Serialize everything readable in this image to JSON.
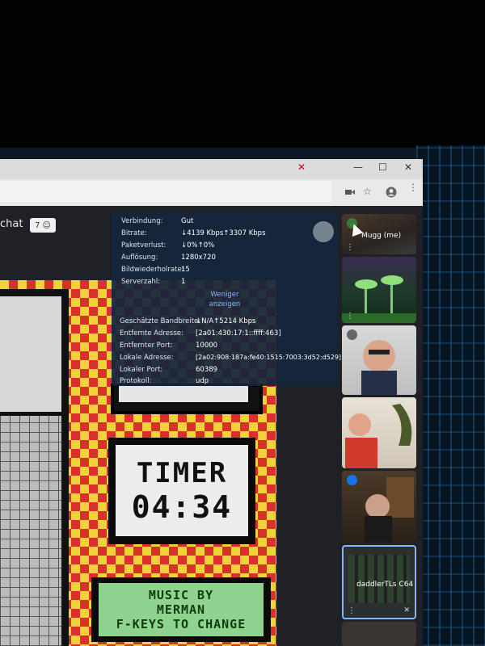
{
  "stats": {
    "rows_top": [
      {
        "label": "Verbindung:",
        "value": "Gut"
      },
      {
        "label": "Bitrate:",
        "value": "↓4139 Kbps↑3307 Kbps"
      },
      {
        "label": "Paketverlust:",
        "value": "↓0%↑0%"
      },
      {
        "label": "Auflösung:",
        "value": "1280x720"
      },
      {
        "label": "Bildwiederholrate:",
        "value": "15"
      },
      {
        "label": "Serverzahl:",
        "value": "1"
      }
    ],
    "toggle_line1": "Weniger",
    "toggle_line2": "anzeigen",
    "rows_bottom": [
      {
        "label": "Geschätzte Bandbreite:",
        "value": "↓N/A↑5214 Kbps"
      },
      {
        "label": "Entfernte Adresse:",
        "value": "[2a01:430:17:1::ffff:463]"
      },
      {
        "label": "Entfernter Port:",
        "value": "10000"
      },
      {
        "label": "Lokale Adresse:",
        "value": "[2a02:908:187a:fe40:1515:7003:3d52:d529]"
      },
      {
        "label": "Lokaler Port:",
        "value": "60389"
      },
      {
        "label": "Protokoll:",
        "value": "udp"
      }
    ]
  },
  "chat": {
    "label": "chat",
    "badge_count": "7"
  },
  "game": {
    "timer_title": "TIMER",
    "timer_value": "04:34",
    "music_line1": "MUSIC BY",
    "music_line2": "MERMAN",
    "music_line3": "F-KEYS TO CHANGE"
  },
  "participants": [
    {
      "name": "Mugg (me)"
    },
    {
      "name": ""
    },
    {
      "name": ""
    },
    {
      "name": ""
    },
    {
      "name": ""
    },
    {
      "name": "daddlerTLs C64"
    }
  ],
  "colors": {
    "accent": "#1a73e8",
    "link": "#8ab4f8",
    "overlay": "#14263c"
  }
}
